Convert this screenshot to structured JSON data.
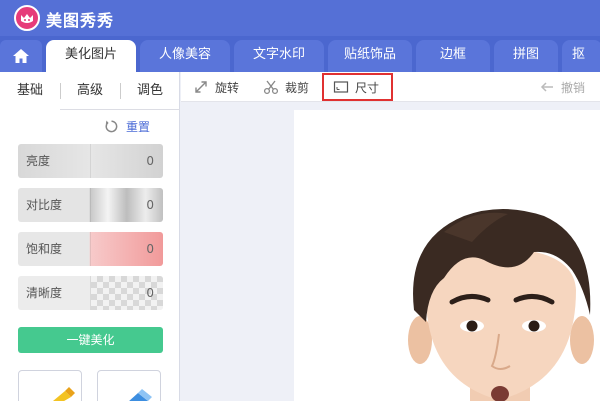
{
  "app": {
    "title": "美图秀秀"
  },
  "tabs": [
    {
      "label": "美化图片",
      "active": true
    },
    {
      "label": "人像美容"
    },
    {
      "label": "文字水印"
    },
    {
      "label": "贴纸饰品"
    },
    {
      "label": "边框"
    },
    {
      "label": "拼图"
    },
    {
      "label": "抠"
    }
  ],
  "panel": {
    "subtabs": [
      "基础",
      "高级",
      "调色"
    ],
    "reset_label": "重置",
    "sliders": [
      {
        "label": "亮度",
        "value": "0"
      },
      {
        "label": "对比度",
        "value": "0"
      },
      {
        "label": "饱和度",
        "value": "0"
      },
      {
        "label": "清晰度",
        "value": "0"
      }
    ],
    "one_key_label": "一键美化"
  },
  "toolbar": {
    "rotate_label": "旋转",
    "crop_label": "裁剪",
    "size_label": "尺寸",
    "undo_label": "撤销"
  },
  "colors": {
    "titlebar": "#5570d6",
    "tabbar": "#4b67cf",
    "accent_green": "#45c98f",
    "highlight_red": "#e03131",
    "link_blue": "#4a6ad6"
  },
  "icons": [
    "home-icon",
    "logo-icon",
    "reset-icon",
    "rotate-icon",
    "crop-icon",
    "size-icon",
    "undo-icon"
  ]
}
